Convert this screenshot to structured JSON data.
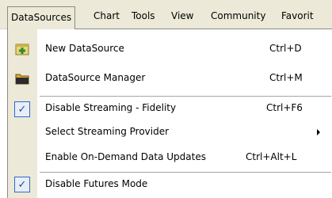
{
  "menubar": {
    "items": [
      "DataSources",
      "Chart",
      "Tools",
      "View",
      "Community",
      "Favorit"
    ]
  },
  "menu": {
    "items": [
      {
        "label": "New DataSource",
        "shortcut": "Ctrl+D",
        "icon": "new-datasource-icon"
      },
      {
        "label": "DataSource Manager",
        "shortcut": "Ctrl+M",
        "icon": "folder-icon"
      },
      {
        "label": "Disable Streaming - Fidelity",
        "shortcut": "Ctrl+F6",
        "checked": true
      },
      {
        "label": "Select Streaming Provider",
        "shortcut": "",
        "submenu": true
      },
      {
        "label": "Enable On-Demand Data Updates",
        "shortcut": "Ctrl+Alt+L"
      },
      {
        "label": "Disable Futures Mode",
        "shortcut": "",
        "checked": true
      }
    ]
  }
}
